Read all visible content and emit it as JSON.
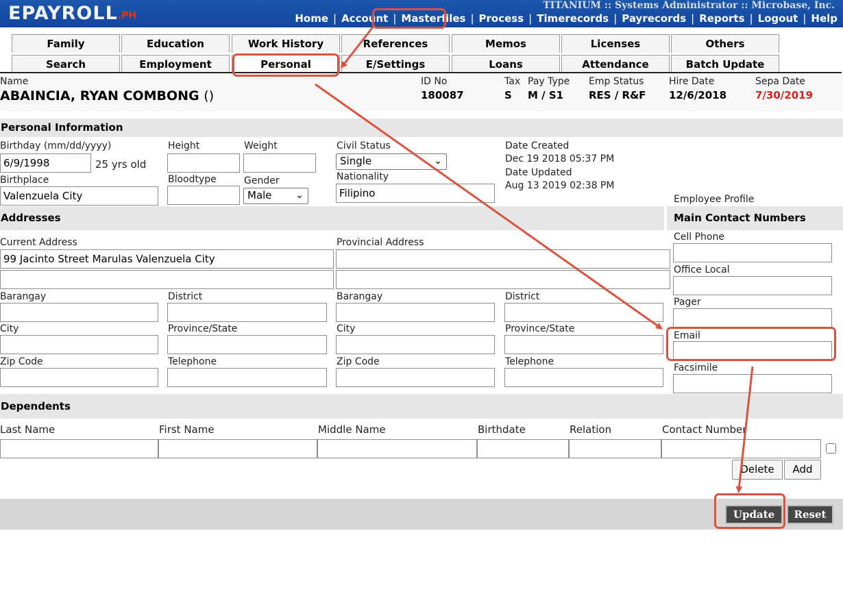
{
  "header": {
    "logo_main": "EPAYROLL",
    "logo_suffix": ".PH",
    "top_info": "TITANIUM :: Systems Administrator :: Microbase, Inc.",
    "nav": [
      "Home",
      "Account",
      "Masterfiles",
      "Process",
      "Timerecords",
      "Payrecords",
      "Reports",
      "Logout",
      "Help"
    ],
    "nav_separator": "|"
  },
  "tabs": {
    "row1": [
      "Family",
      "Education",
      "Work History",
      "References",
      "Memos",
      "Licenses",
      "Others"
    ],
    "row2": [
      "Search",
      "Employment",
      "Personal",
      "E/Settings",
      "Loans",
      "Attendance",
      "Batch Update"
    ]
  },
  "employee": {
    "name_label": "Name",
    "name": "ABAINCIA, RYAN COMBONG",
    "name_suffix": "()",
    "id_label": "ID No",
    "id": "180087",
    "tax_label": "Tax",
    "tax": "S",
    "paytype_label": "Pay Type",
    "paytype": "M / S1",
    "empstatus_label": "Emp Status",
    "empstatus": "RES / R&F",
    "hire_label": "Hire Date",
    "hire": "12/6/2018",
    "sepa_label": "Sepa Date",
    "sepa": "7/30/2019",
    "sepa_color": "#e0201c"
  },
  "personal": {
    "section_title": "Personal Information",
    "birthday_label": "Birthday (mm/dd/yyyy)",
    "birthday": "6/9/1998",
    "age": "25 yrs old",
    "height_label": "Height",
    "weight_label": "Weight",
    "civil_label": "Civil Status",
    "civil": "Single",
    "birthplace_label": "Birthplace",
    "birthplace": "Valenzuela City",
    "bloodtype_label": "Bloodtype",
    "gender_label": "Gender",
    "gender": "Male",
    "nationality_label": "Nationality",
    "nationality": "Filipino",
    "created_label": "Date Created",
    "created": "Dec 19 2018 05:37 PM",
    "updated_label": "Date Updated",
    "updated": "Aug 13 2019 02:38 PM",
    "profile_label": "Employee Profile"
  },
  "addresses": {
    "section_title": "Addresses",
    "current_label": "Current Address",
    "current_line1": "99 Jacinto Street Marulas Valenzuela City",
    "provincial_label": "Provincial Address",
    "barangay_label": "Barangay",
    "district_label": "District",
    "city_label": "City",
    "province_label": "Province/State",
    "zip_label": "Zip Code",
    "telephone_label": "Telephone"
  },
  "contacts": {
    "section_title": "Main Contact Numbers",
    "cell_label": "Cell Phone",
    "office_label": "Office Local",
    "pager_label": "Pager",
    "email_label": "Email",
    "fax_label": "Facsimile"
  },
  "dependents": {
    "section_title": "Dependents",
    "columns": [
      "Last Name",
      "First Name",
      "Middle Name",
      "Birthdate",
      "Relation",
      "Contact Number"
    ],
    "delete_label": "Delete",
    "add_label": "Add"
  },
  "actions": {
    "update_label": "Update",
    "reset_label": "Reset"
  },
  "annotation_color": "#d9533e"
}
